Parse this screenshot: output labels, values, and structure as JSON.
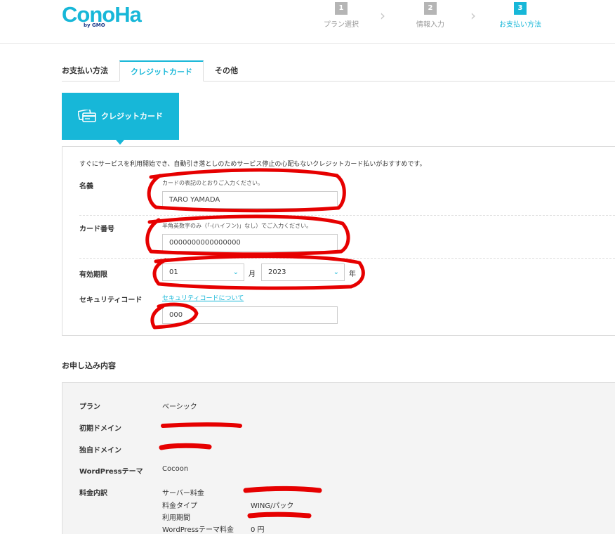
{
  "header": {
    "logo": "ConoHa",
    "logo_sub": "by GMO",
    "steps": [
      {
        "num": "1",
        "label": "プラン選択"
      },
      {
        "num": "2",
        "label": "情報入力"
      },
      {
        "num": "3",
        "label": "お支払い方法"
      }
    ]
  },
  "payment": {
    "section_label": "お支払い方法",
    "tabs": [
      "クレジットカード",
      "その他"
    ],
    "card_tile_label": "クレジットカード",
    "intro": "すぐにサービスを利用開始でき、自動引き落としのためサービス停止の心配もないクレジットカード払いがおすすめです。",
    "fields": {
      "name_label": "名義",
      "name_hint": "カードの表記のとおりご入力ください。",
      "name_value": "TARO YAMADA",
      "number_label": "カード番号",
      "number_hint": "半角英数字のみ（「-(ハイフン)」なし）でご入力ください。",
      "number_value": "0000000000000000",
      "expiry_label": "有効期限",
      "expiry_month": "01",
      "expiry_month_unit": "月",
      "expiry_year": "2023",
      "expiry_year_unit": "年",
      "security_label": "セキュリティコード",
      "security_link": "セキュリティコードについて",
      "security_value": "000"
    }
  },
  "summary": {
    "title": "お申し込み内容",
    "plan_label": "プラン",
    "plan_value": "ベーシック",
    "initial_domain_label": "初期ドメイン",
    "own_domain_label": "独自ドメイン",
    "wp_theme_label": "WordPressテーマ",
    "wp_theme_value": "Cocoon",
    "fee_label": "料金内訳",
    "fee_rows": [
      {
        "name": "サーバー料金",
        "value": ""
      },
      {
        "name": "料金タイプ",
        "value": "WING/パック"
      },
      {
        "name": "利用期間",
        "value": ""
      },
      {
        "name": "WordPressテーマ料金",
        "value": "0 円"
      }
    ]
  },
  "colors": {
    "accent": "#17b7d8",
    "annotation": "#e60000"
  }
}
